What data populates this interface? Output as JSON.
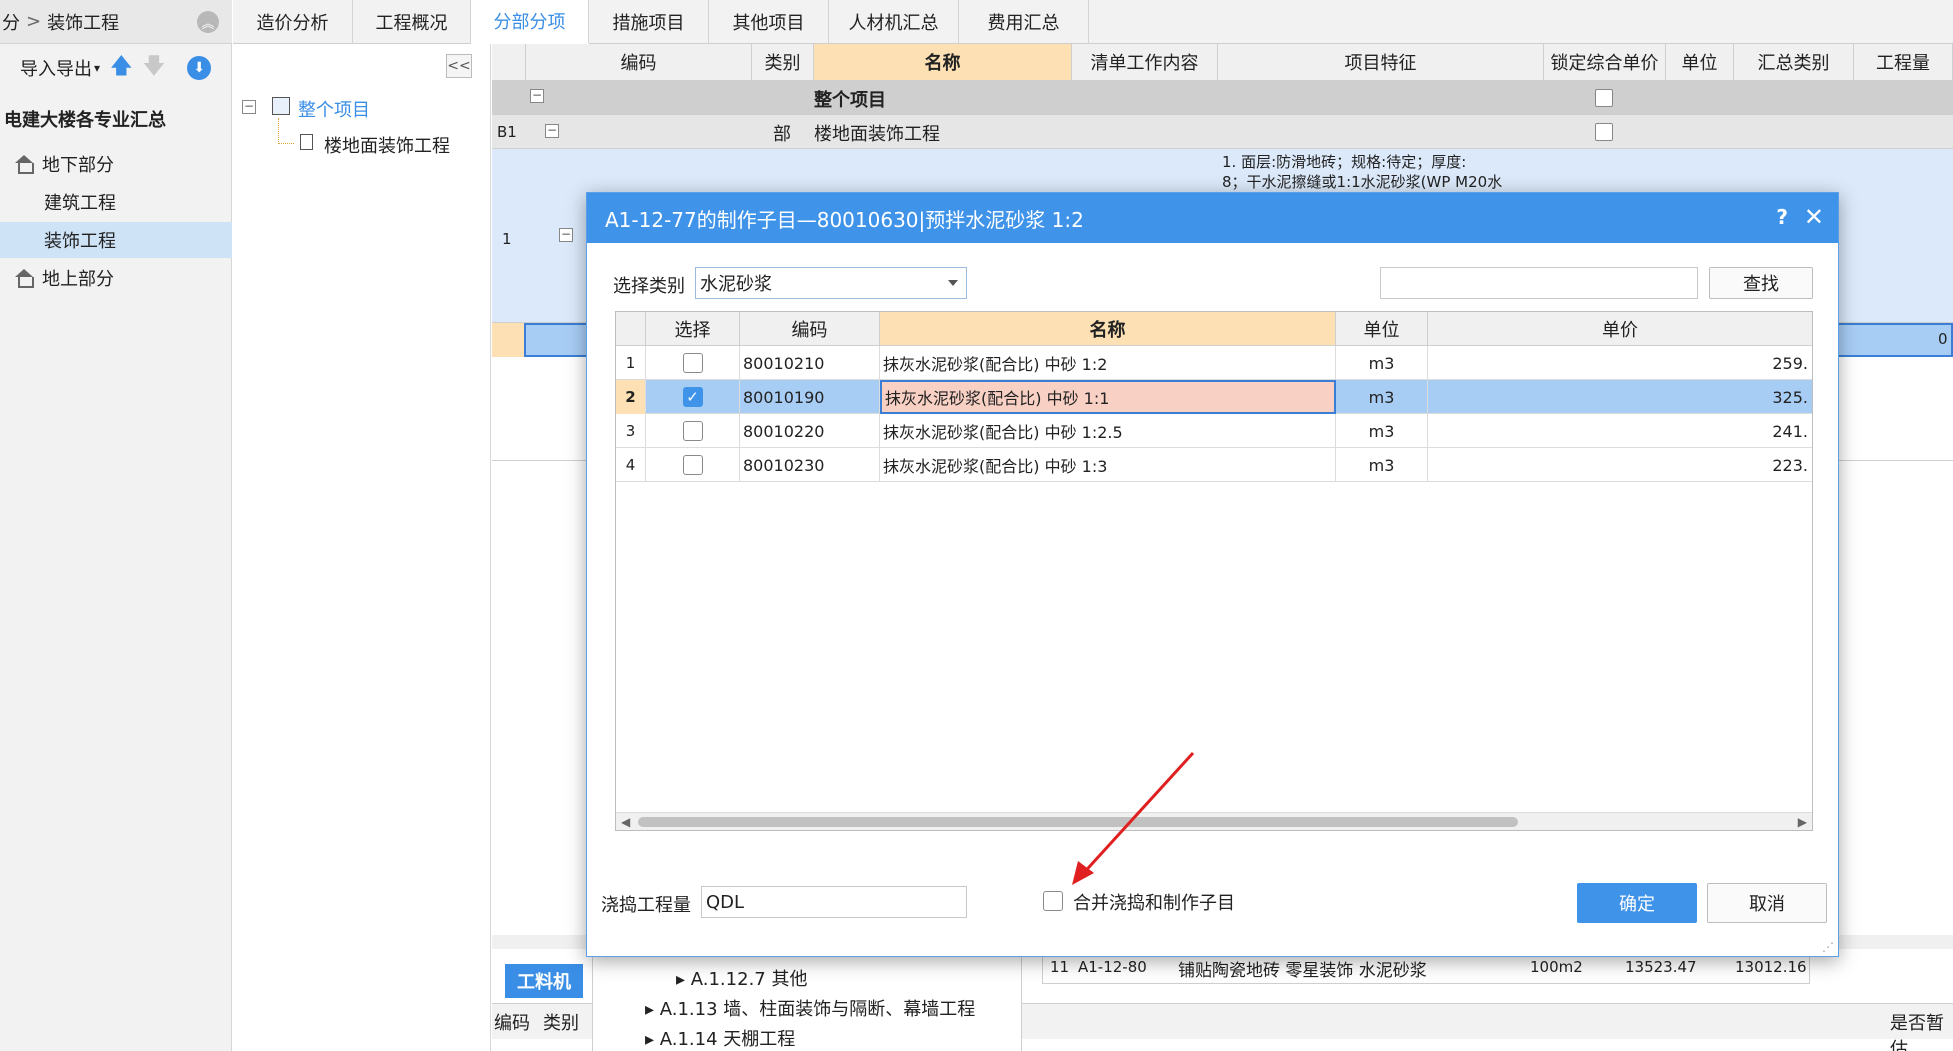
{
  "breadcrumb": {
    "prefix": "分",
    "sep": ">",
    "current": "装饰工程"
  },
  "left_toolbar": {
    "io_label": "导入导出"
  },
  "project": {
    "name": "电建大楼各专业汇总"
  },
  "nav": [
    {
      "label": "地下部分",
      "icon": "home-icon"
    },
    {
      "label": "建筑工程"
    },
    {
      "label": "装饰工程",
      "active": true
    },
    {
      "label": "地上部分",
      "icon": "home-icon"
    }
  ],
  "tree": {
    "root": "整个项目",
    "child": "楼地面装饰工程",
    "collapse": "<<"
  },
  "tabs": [
    "造价分析",
    "工程概况",
    "分部分项",
    "措施项目",
    "其他项目",
    "人材机汇总",
    "费用汇总"
  ],
  "main_grid": {
    "headers": [
      "编码",
      "类别",
      "名称",
      "清单工作内容",
      "项目特征",
      "锁定综合单价",
      "单位",
      "汇总类别",
      "工程量"
    ],
    "rows": [
      {
        "name": "整个项目"
      },
      {
        "code": "B1",
        "type": "部",
        "name": "楼地面装饰工程"
      },
      {
        "index": "1",
        "feature_line1": "1. 面层:防滑地砖；规格:待定；厚度:",
        "feature_line2": "8；干水泥擦缝或1:1水泥砂浆(WP M20水"
      }
    ],
    "row4_value": "0"
  },
  "bottom": {
    "tab_label": "工料机",
    "header_left": [
      "编码",
      "类别"
    ],
    "header_right": "是否暂估",
    "tree_items": [
      "A.1.12.7 其他",
      "A.1.13 墙、柱面装饰与隔断、幕墙工程",
      "A.1.14 天棚工程"
    ],
    "row": {
      "index": "11",
      "code": "A1-12-80",
      "name": "铺贴陶瓷地砖 零星装饰 水泥砂浆",
      "unit": "100m2",
      "price1": "13523.47",
      "price2": "13012.16"
    }
  },
  "dialog": {
    "title": "A1-12-77的制作子目—80010630|预拌水泥砂浆 1:2",
    "help": "?",
    "close": "✕",
    "category_label": "选择类别",
    "category_value": "水泥砂浆",
    "search_value": "",
    "search_button": "查找",
    "table": {
      "headers": [
        "选择",
        "编码",
        "名称",
        "单位",
        "单价"
      ],
      "rows": [
        {
          "index": "1",
          "checked": false,
          "code": "80010210",
          "name": "抹灰水泥砂浆(配合比) 中砂 1:2",
          "unit": "m3",
          "price": "259."
        },
        {
          "index": "2",
          "checked": true,
          "code": "80010190",
          "name": "抹灰水泥砂浆(配合比) 中砂 1:1",
          "unit": "m3",
          "price": "325."
        },
        {
          "index": "3",
          "checked": false,
          "code": "80010220",
          "name": "抹灰水泥砂浆(配合比) 中砂 1:2.5",
          "unit": "m3",
          "price": "241."
        },
        {
          "index": "4",
          "checked": false,
          "code": "80010230",
          "name": "抹灰水泥砂浆(配合比) 中砂 1:3",
          "unit": "m3",
          "price": "223."
        }
      ]
    },
    "pour_label": "浇捣工程量",
    "pour_value": "QDL",
    "merge_label": "合并浇捣和制作子目",
    "ok_button": "确定",
    "cancel_button": "取消"
  },
  "colors": {
    "accent": "#3f94ea",
    "header_highlight": "#fde0b4",
    "selected_row": "#a8cdf5",
    "annotation_arrow": "#e02020"
  }
}
